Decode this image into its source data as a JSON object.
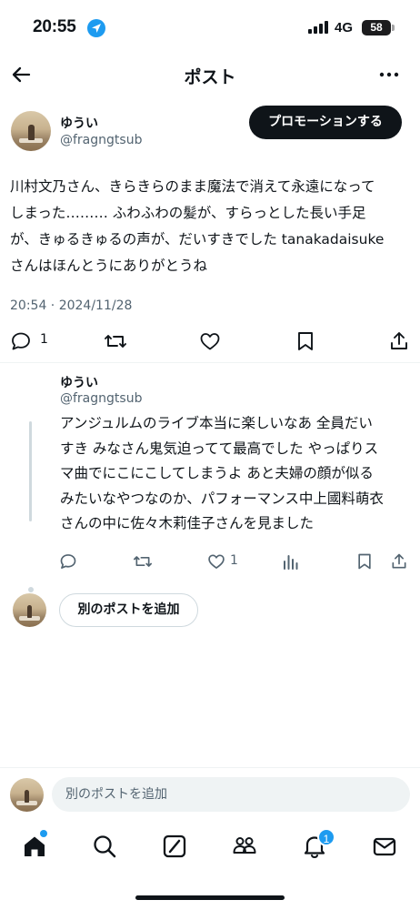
{
  "status_bar": {
    "time": "20:55",
    "network": "4G",
    "battery": "58"
  },
  "header": {
    "title": "ポスト"
  },
  "main_post": {
    "name": "ゆうい",
    "handle": "@fragngtsub",
    "promote_label": "プロモーションする",
    "text": "川村文乃さん、きらきらのまま魔法で消えて永遠になって\nしまった……… ふわふわの髪が、すらっとした長い手足\nが、きゅるきゅるの声が、だいすきでした tanakadaisuke\nさんはほんとうにありがとうね",
    "meta": "20:54 · 2024/11/28",
    "reply_count": "1"
  },
  "reply_post": {
    "name": "ゆうい",
    "handle": "@fragngtsub",
    "text": "アンジュルムのライブ本当に楽しいなあ 全員だい\nすき みなさん鬼気迫ってて最高でした やっぱりス\nマ曲でにこにこしてしまうよ あと夫婦の顔が似る\nみたいなやつなのか、パフォーマンス中上國料萌衣\nさんの中に佐々木莉佳子さんを見ました",
    "like_count": "1"
  },
  "add_post": {
    "label": "別のポストを追加"
  },
  "compose": {
    "placeholder": "別のポストを追加"
  },
  "tab_bar": {
    "notifications_badge": "1"
  },
  "colors": {
    "accent": "#1d9bf0",
    "text": "#0f1419",
    "muted": "#536471",
    "border": "#cfd9de"
  }
}
